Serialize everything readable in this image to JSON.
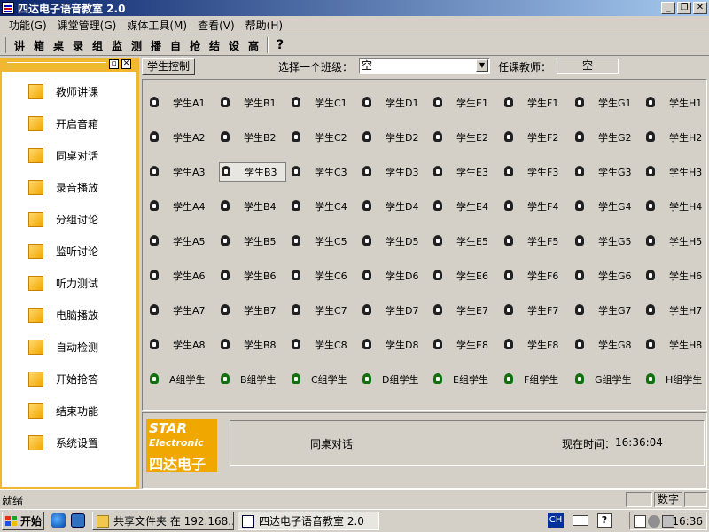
{
  "window": {
    "title": "四达电子语音教室 2.0",
    "buttons": {
      "minimize": "_",
      "maximize": "❐",
      "close": "✕"
    }
  },
  "menu": [
    "功能(G)",
    "课堂管理(G)",
    "媒体工具(M)",
    "查看(V)",
    "帮助(H)"
  ],
  "toolbar": {
    "items": [
      "讲",
      "箱",
      "桌",
      "录",
      "组",
      "监",
      "测",
      "播",
      "自",
      "抢",
      "结",
      "设",
      "高"
    ],
    "help": "?"
  },
  "sidebar": {
    "buttons": {
      "restore": "▫",
      "close": "✕"
    },
    "items": [
      "教师讲课",
      "开启音箱",
      "同桌对话",
      "录音播放",
      "分组讨论",
      "监听讨论",
      "听力测试",
      "电脑播放",
      "自动检测",
      "开始抢答",
      "结束功能",
      "系统设置"
    ]
  },
  "topbar": {
    "tab": "学生控制",
    "class_label": "选择一个班级：",
    "class_value": "空",
    "teacher_label": "任课教师：",
    "teacher_value": "空"
  },
  "students": {
    "columns": [
      "A",
      "B",
      "C",
      "D",
      "E",
      "F",
      "G",
      "H"
    ],
    "rows": [
      [
        "学生A1",
        "学生B1",
        "学生C1",
        "学生D1",
        "学生E1",
        "学生F1",
        "学生G1",
        "学生H1"
      ],
      [
        "学生A2",
        "学生B2",
        "学生C2",
        "学生D2",
        "学生E2",
        "学生F2",
        "学生G2",
        "学生H2"
      ],
      [
        "学生A3",
        "学生B3",
        "学生C3",
        "学生D3",
        "学生E3",
        "学生F3",
        "学生G3",
        "学生H3"
      ],
      [
        "学生A4",
        "学生B4",
        "学生C4",
        "学生D4",
        "学生E4",
        "学生F4",
        "学生G4",
        "学生H4"
      ],
      [
        "学生A5",
        "学生B5",
        "学生C5",
        "学生D5",
        "学生E5",
        "学生F5",
        "学生G5",
        "学生H5"
      ],
      [
        "学生A6",
        "学生B6",
        "学生C6",
        "学生D6",
        "学生E6",
        "学生F6",
        "学生G6",
        "学生H6"
      ],
      [
        "学生A7",
        "学生B7",
        "学生C7",
        "学生D7",
        "学生E7",
        "学生F7",
        "学生G7",
        "学生H7"
      ],
      [
        "学生A8",
        "学生B8",
        "学生C8",
        "学生D8",
        "学生E8",
        "学生F8",
        "学生G8",
        "学生H8"
      ]
    ],
    "groups": [
      "A组学生",
      "B组学生",
      "C组学生",
      "D组学生",
      "E组学生",
      "F组学生",
      "G组学生",
      "H组学生"
    ],
    "selected": "学生B3"
  },
  "info": {
    "logo_line1": "STAR",
    "logo_line2": "Electronic",
    "logo_line3": "四达电子",
    "mode": "同桌对话",
    "time_label": "现在时间：",
    "time": "16:36:04"
  },
  "statusbar": {
    "text": "就绪",
    "numlock": "数字"
  },
  "taskbar": {
    "start": "开始",
    "tasks": [
      "共享文件夹 在 192.168...",
      "四达电子语音教室 2.0"
    ],
    "lang": "CH",
    "clock": "16:36"
  },
  "colors": {
    "sidebar_accent": "#f0b830",
    "title_gradient_start": "#0a246a",
    "title_gradient_end": "#a6caf0"
  }
}
